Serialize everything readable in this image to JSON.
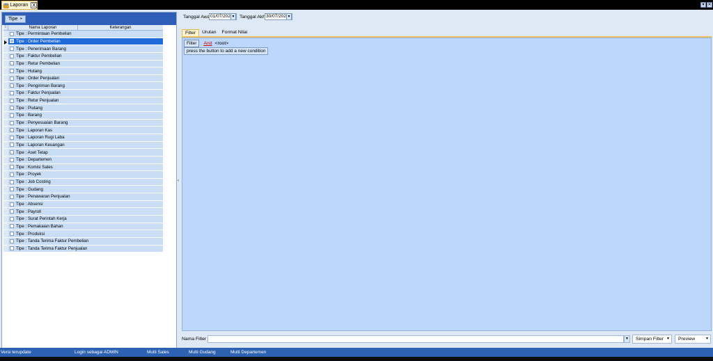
{
  "document_tab": {
    "label": "Laporan",
    "close": "X",
    "icon": "report-folder-icon"
  },
  "window_controls": {
    "dropdown": "▾",
    "close": "✕"
  },
  "group_panel": {
    "chip_label": "Tipe"
  },
  "grid": {
    "indicator_header": "⁞",
    "columns": [
      "Nama Laporan",
      "Keterangan"
    ],
    "selected_index": 1,
    "rows": [
      "Tipe : Permintaan Pembelian",
      "Tipe : Order Pembelian",
      "Tipe : Penerimaan Barang",
      "Tipe : Faktur Pembelian",
      "Tipe : Retur Pembelian",
      "Tipe : Hutang",
      "Tipe : Order Penjualan",
      "Tipe : Pengiriman Barang",
      "Tipe : Faktur Penjualan",
      "Tipe : Retur Penjualan",
      "Tipe : Piutang",
      "Tipe : Barang",
      "Tipe : Penyesuaian Barang",
      "Tipe : Laporan Kas",
      "Tipe : Laporan Rugi Laba",
      "Tipe : Laporan Keuangan",
      "Tipe : Aset Tetap",
      "Tipe : Departemen",
      "Tipe : Komisi Sales",
      "Tipe : Proyek",
      "Tipe : Job Costing",
      "Tipe : Gudang",
      "Tipe : Penawaran Penjualan",
      "Tipe : Absensi",
      "Tipe : Payroll",
      "Tipe : Surat Perintah Kerja",
      "Tipe : Pemakaian Bahan",
      "Tipe : Produksi",
      "Tipe : Tanda Terima Faktur Pembelian",
      "Tipe : Tanda Terima Faktur Penjualan"
    ]
  },
  "dates": {
    "start_label": "Tanggal Awal",
    "start_value": "01/07/202",
    "end_label": "Tanggal Akhi",
    "end_value": "30/07/202"
  },
  "tabs": [
    "Filter",
    "Urutan",
    "Format Nilai"
  ],
  "active_tab": 0,
  "filter": {
    "chip": "Filter",
    "operator": "And",
    "root": "<root>",
    "hint": "press the button to add a new condition"
  },
  "bottom": {
    "nama_filter_label": "Nama Filter",
    "nama_filter_value": "",
    "simpan_filter": "Simpan Filter",
    "preview": "Preview"
  },
  "status": {
    "version": "Versi terupdate",
    "login": "Login sebagai ADMIN",
    "multi_sales": "Multi Sales",
    "multi_gudang": "Multi Gudang",
    "multi_departemen": "Multi Departemen"
  },
  "colors": {
    "accent": "#2f5eb8",
    "selection": "#1e6ad8",
    "filter_bg": "#bcd7fb",
    "tab_active": "#fff4cf",
    "status_bar": "#2d62b3"
  }
}
